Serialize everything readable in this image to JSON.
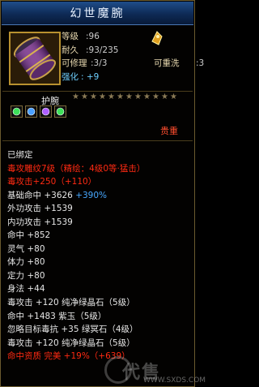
{
  "title": "幻世魔腕",
  "header": {
    "level_label": "等级",
    "level_value": ":96",
    "durability_label": "耐久",
    "durability_value": ":93/235",
    "repair_label": "可修理",
    "repair_value": ":3/3",
    "rewash_label": "可重洗",
    "rewash_value": ":3",
    "strength_label": "强化",
    "strength_value": ": +9"
  },
  "item_type": "护腕",
  "stars": [
    "★",
    "★",
    "★",
    "★",
    "★",
    "★",
    "★",
    "★",
    "★",
    "★",
    "★",
    "★"
  ],
  "sockets": [
    "green-gem-icon",
    "blue-gem-icon",
    "purple-gem-icon",
    "green-gem-icon"
  ],
  "valuable_label": "贵重",
  "attributes": [
    {
      "text": "已绑定",
      "color": "white"
    },
    {
      "text": "毒攻雕纹7级（精绘：4级0等·猛击）",
      "color": "red"
    },
    {
      "text": "毒攻击+250（+110）",
      "color": "red"
    },
    {
      "text": "基础命中 +3626",
      "extra": " +390%",
      "color": "white"
    },
    {
      "text": "外功攻击 +1539",
      "color": "white"
    },
    {
      "text": "内功攻击 +1539",
      "color": "white"
    },
    {
      "text": "命中 +852",
      "color": "white"
    },
    {
      "text": "灵气 +80",
      "color": "white"
    },
    {
      "text": "体力 +80",
      "color": "white"
    },
    {
      "text": "定力 +80",
      "color": "white"
    },
    {
      "text": "身法 +44",
      "color": "white"
    },
    {
      "text": "毒攻击 +120 纯净绿晶石（5级）",
      "color": "white"
    },
    {
      "text": "命中 +1483 紫玉（5级）",
      "color": "white"
    },
    {
      "text": "忽略目标毒抗 +35 绿冥石（4级）",
      "color": "white"
    },
    {
      "text": "毒攻击 +120 纯净绿晶石（5级）",
      "color": "white"
    },
    {
      "text": "命中资质  完美 +19%（+639）",
      "color": "red"
    }
  ],
  "watermark": "代售",
  "watermark_url": "WWW.SXDS.COM",
  "colors": {
    "red": "#ff2a12",
    "blue": "#47a8ff",
    "white": "#e6e6e6",
    "gold_border": "#b8912f"
  }
}
